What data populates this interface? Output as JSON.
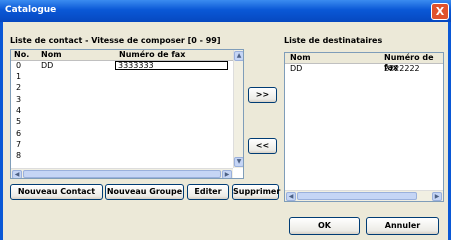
{
  "window": {
    "title": "Catalogue",
    "close_glyph": "X"
  },
  "contacts": {
    "label": "Liste de contact - Vitesse de composer [0 - 99]",
    "columns": [
      "No.",
      "Nom",
      "Numéro de fax"
    ],
    "rows": [
      {
        "no": "0",
        "nom": "DD",
        "fax": "3333333"
      },
      {
        "no": "1",
        "nom": "",
        "fax": ""
      },
      {
        "no": "2",
        "nom": "",
        "fax": ""
      },
      {
        "no": "3",
        "nom": "",
        "fax": ""
      },
      {
        "no": "4",
        "nom": "",
        "fax": ""
      },
      {
        "no": "5",
        "nom": "",
        "fax": ""
      },
      {
        "no": "6",
        "nom": "",
        "fax": ""
      },
      {
        "no": "7",
        "nom": "",
        "fax": ""
      },
      {
        "no": "8",
        "nom": "",
        "fax": ""
      }
    ]
  },
  "recipients": {
    "label": "Liste de destinataires",
    "columns": [
      "Nom",
      "Numéro de fax"
    ],
    "rows": [
      {
        "nom": "DD",
        "fax": "2222222"
      }
    ]
  },
  "buttons": {
    "add": ">>",
    "remove": "<<",
    "new_contact": "Nouveau Contact",
    "new_group": "Nouveau Groupe",
    "edit": "Editer",
    "delete": "Supprimer",
    "ok": "OK",
    "cancel": "Annuler"
  },
  "colors": {
    "title_bar": "#0a58d6",
    "dialog_bg": "#ece9d8",
    "list_border": "#7f9db9"
  }
}
